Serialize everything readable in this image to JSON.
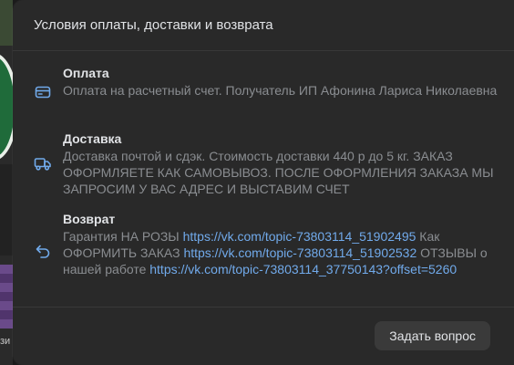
{
  "background": {
    "bottom_left_text": "зи"
  },
  "modal": {
    "title": "Условия оплаты, доставки и возврата",
    "sections": {
      "payment": {
        "icon": "card-icon",
        "title": "Оплата",
        "text": "Оплата на расчетный счет. Получатель ИП Афонина Лариса Николаевна"
      },
      "delivery": {
        "icon": "truck-icon",
        "title": "Доставка",
        "text": "Доставка почтой и сдэк. Стоимость доставки 440 р до 5 кг. ЗАКАЗ ОФОРМЛЯЕТЕ КАК САМОВЫВОЗ. ПОСЛЕ ОФОРМЛЕНИЯ ЗАКАЗА МЫ ЗАПРОСИМ У ВАС АДРЕС И ВЫСТАВИМ СЧЕТ"
      },
      "return": {
        "icon": "return-arrow-icon",
        "title": "Возврат",
        "text_1": "Гарантия НА РОЗЫ",
        "link_1": "https://vk.com/topic-73803114_51902495",
        "text_2": "Как ОФОРМИТЬ ЗАКАЗ",
        "link_2": "https://vk.com/topic-73803114_51902532",
        "text_3": "ОТЗЫВЫ о нашей работе",
        "link_3": "https://vk.com/topic-73803114_37750143?offset=5260"
      }
    },
    "ask_button_label": "Задать вопрос"
  },
  "colors": {
    "modal_bg": "#292929",
    "title_text": "#e1e3e6",
    "secondary_text": "#8a8d91",
    "link": "#71aaeb",
    "icon_accent": "#71aaeb"
  }
}
